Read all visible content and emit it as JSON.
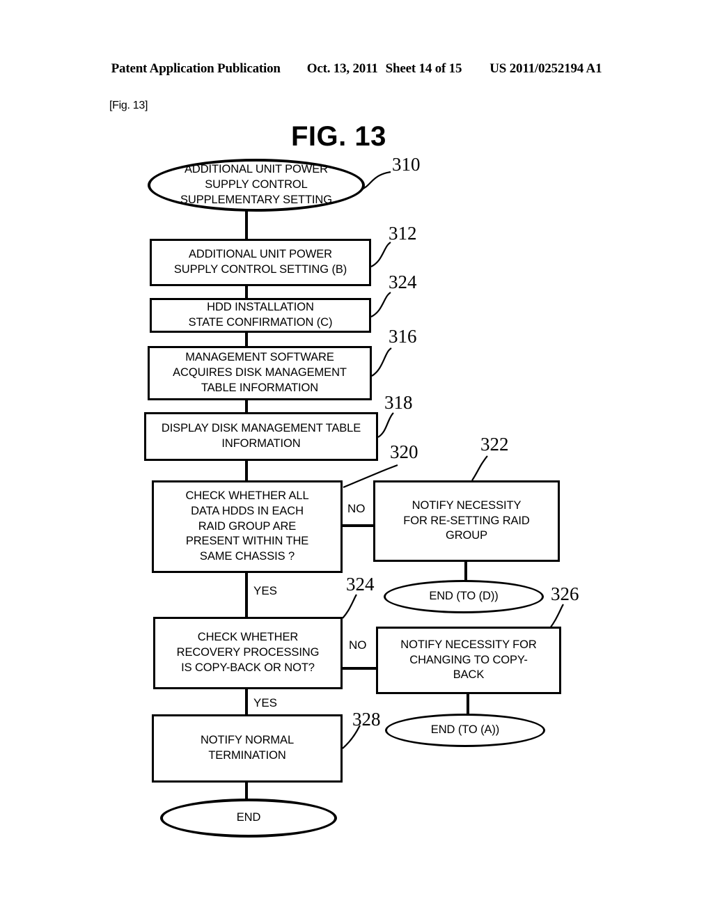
{
  "header": {
    "publication": "Patent Application Publication",
    "date": "Oct. 13, 2011",
    "sheet": "Sheet 14 of 15",
    "doc_number": "US 2011/0252194 A1"
  },
  "figure": {
    "tag": "[Fig. 13]",
    "title": "FIG. 13"
  },
  "flow": {
    "nodes": [
      {
        "id": "310",
        "shape": "oval",
        "text": "ADDITIONAL UNIT POWER\nSUPPLY CONTROL\nSUPPLEMENTARY SETTING"
      },
      {
        "id": "312",
        "shape": "box",
        "text": "ADDITIONAL UNIT POWER\nSUPPLY CONTROL SETTING (B)"
      },
      {
        "id": "324",
        "shape": "box",
        "text": "HDD INSTALLATION\nSTATE CONFIRMATION (C)"
      },
      {
        "id": "316",
        "shape": "box",
        "text": "MANAGEMENT SOFTWARE\nACQUIRES DISK MANAGEMENT\nTABLE INFORMATION"
      },
      {
        "id": "318",
        "shape": "box",
        "text": "DISPLAY DISK MANAGEMENT TABLE\nINFORMATION"
      },
      {
        "id": "320",
        "shape": "box",
        "text": "CHECK WHETHER ALL\nDATA HDDS IN EACH\nRAID GROUP ARE\nPRESENT WITHIN THE\nSAME CHASSIS ?"
      },
      {
        "id": "322",
        "shape": "box",
        "text": "NOTIFY NECESSITY\nFOR RE-SETTING RAID\nGROUP"
      },
      {
        "id": "end-d",
        "shape": "oval",
        "text": "END  (TO (D))"
      },
      {
        "id": "324b",
        "shape": "box",
        "text": "CHECK WHETHER\nRECOVERY PROCESSING\nIS COPY-BACK OR NOT?"
      },
      {
        "id": "326",
        "shape": "box",
        "text": "NOTIFY NECESSITY FOR\nCHANGING TO COPY-\nBACK"
      },
      {
        "id": "end-a",
        "shape": "oval",
        "text": "END (TO (A))"
      },
      {
        "id": "328",
        "shape": "box",
        "text": "NOTIFY NORMAL\nTERMINATION"
      },
      {
        "id": "end",
        "shape": "oval",
        "text": "END"
      }
    ],
    "branch_labels": [
      "NO",
      "YES",
      "NO",
      "YES"
    ],
    "references": [
      {
        "num": "310"
      },
      {
        "num": "312"
      },
      {
        "num": "324"
      },
      {
        "num": "316"
      },
      {
        "num": "318"
      },
      {
        "num": "320"
      },
      {
        "num": "322"
      },
      {
        "num": "324"
      },
      {
        "num": "326"
      },
      {
        "num": "328"
      }
    ]
  }
}
